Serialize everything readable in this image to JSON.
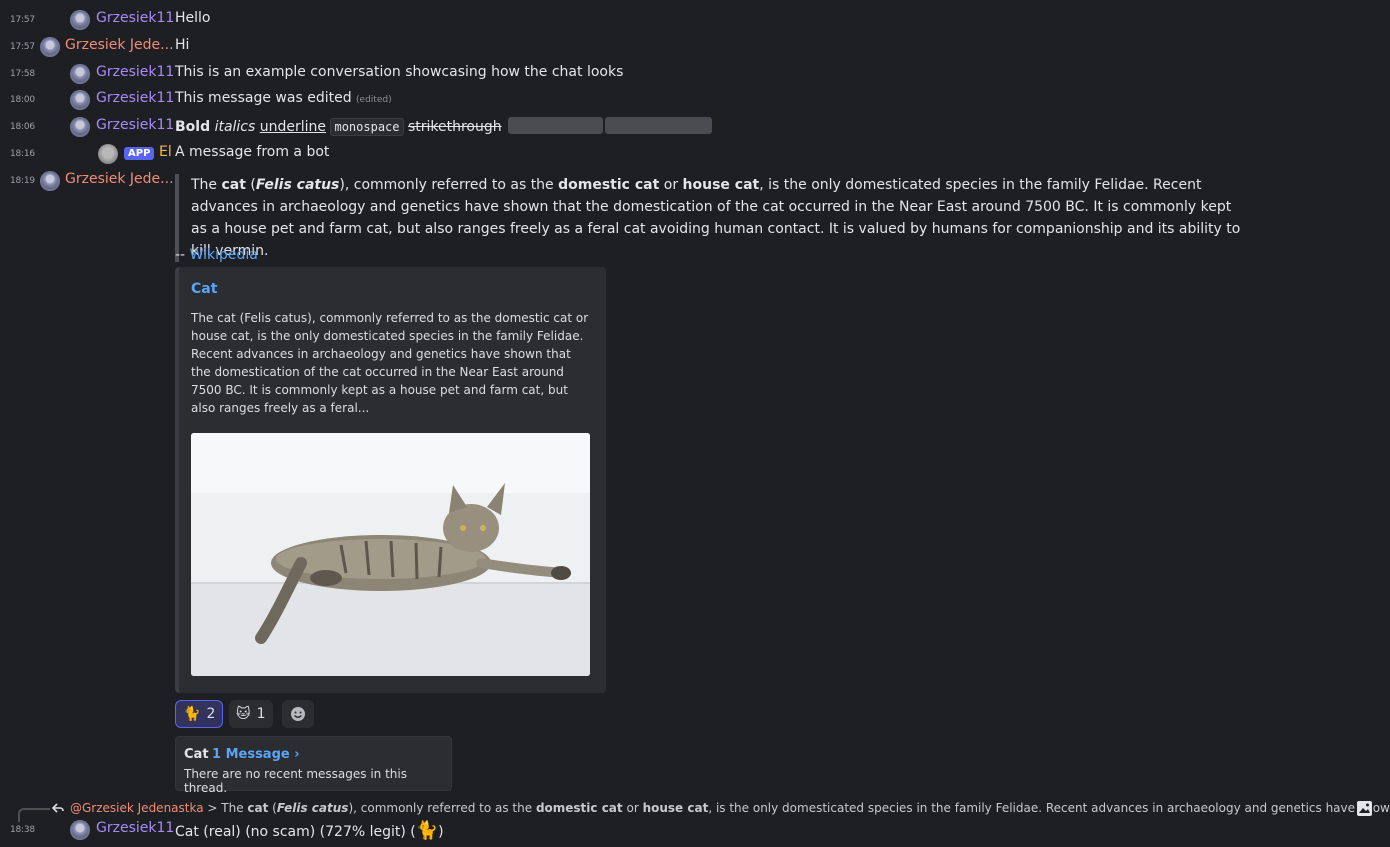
{
  "messages": [
    {
      "time": "17:57",
      "user": "Grzesiek11",
      "text": "Hello"
    },
    {
      "time": "17:57",
      "user": "Grzesiek Jede...",
      "text": "Hi"
    },
    {
      "time": "17:58",
      "user": "Grzesiek11",
      "text": "This is an example conversation showcasing how the chat looks"
    },
    {
      "time": "18:00",
      "user": "Grzesiek11",
      "text": "This message was edited",
      "edited": "(edited)"
    },
    {
      "time": "18:06",
      "user": "Grzesiek11",
      "bold": "Bold",
      "italics": "italics",
      "underline": "underline",
      "monospace": "monospace",
      "strike": "strikethrough"
    },
    {
      "time": "18:16",
      "badge": "APP",
      "user": "El",
      "text": "A message from a bot"
    },
    {
      "time": "18:19",
      "user": "Grzesiek Jede..."
    }
  ],
  "quote": {
    "p1": "The ",
    "cat": "cat",
    "p2": " (",
    "felis": "Felis catus",
    "p3": "), commonly referred to as the ",
    "domestic": "domestic cat",
    "p4": " or ",
    "house": "house cat",
    "p5": ", is the only domesticated species in the family Felidae. Recent advances in archaeology and genetics have shown that the domestication of the cat occurred in the Near East around 7500 BC. It is commonly kept as a house pet and farm cat, but also ranges freely as a feral cat avoiding human contact. It is valued by humans for companionship and its ability to kill vermin.",
    "attrib_prefix": "-- ",
    "attrib_link": "Wikipedia"
  },
  "embed": {
    "title": "Cat",
    "description": "The cat (Felis catus), commonly referred to as the domestic cat or house cat, is the only domesticated species in the family Felidae. Recent advances in archaeology and genetics have shown that the domestication of the cat occurred in the Near East around 7500 BC. It is commonly kept as a house pet and farm cat, but also ranges freely as a feral..."
  },
  "reactions": [
    {
      "emoji": "🐈",
      "count": "2",
      "active": true
    },
    {
      "emoji": "🐱",
      "count": "1",
      "active": false
    }
  ],
  "thread": {
    "name": "Cat",
    "count": "1 Message ›",
    "empty": "There are no recent messages in this thread."
  },
  "reply": {
    "mention": "@Grzesiek Jedenastka",
    "prefix": " > The ",
    "cat": "cat",
    "p2": " (",
    "felis": "Felis catus",
    "p3": "), commonly referred to as the ",
    "domestic": "domestic cat",
    "p4": " or ",
    "house": "house cat",
    "p5": ", is the only domesticated species in the family Felidae. Recent advances in archaeology and genetics have shown t..."
  },
  "last": {
    "time": "18:38",
    "user": "Grzesiek11",
    "text": "Cat (real) (no scam) (727% legit) (",
    "emoji": "🐈",
    "close": ")"
  },
  "colors": {
    "user_a": "#a78bfa",
    "user_b": "#f38b78",
    "bot": "#f3b94d",
    "link": "#5aa5f7",
    "accent": "#5865f2"
  }
}
